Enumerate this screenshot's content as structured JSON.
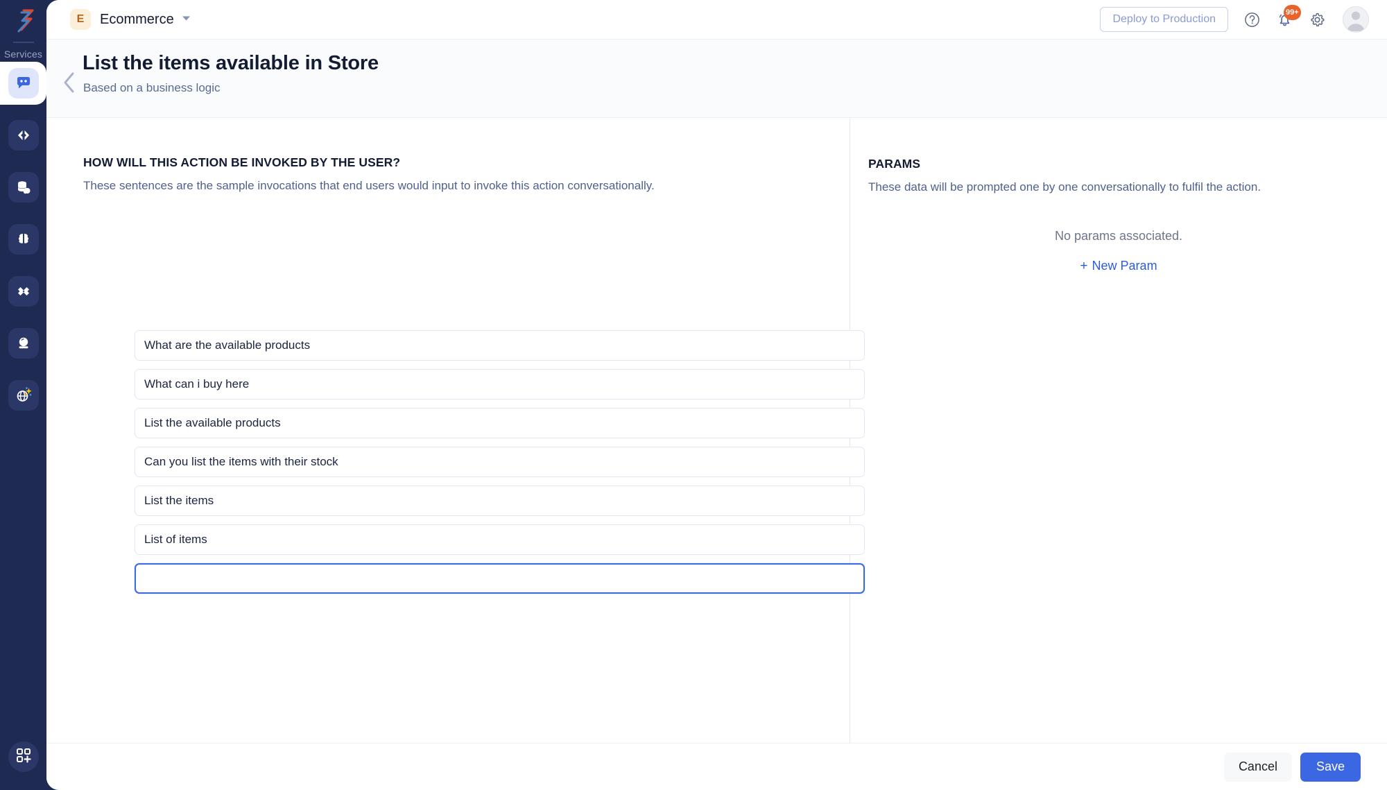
{
  "sidebar": {
    "logo_icon": "zep-logo-icon",
    "section_label": "Services",
    "items": [
      {
        "icon": "chat-bubble-icon",
        "name": "conversations",
        "active": true
      },
      {
        "icon": "code-brackets-icon",
        "name": "code",
        "active": false
      },
      {
        "icon": "database-cloud-icon",
        "name": "database",
        "active": false
      },
      {
        "icon": "brain-icon",
        "name": "intelligence",
        "active": false
      },
      {
        "icon": "infinity-link-icon",
        "name": "integrations",
        "active": false
      },
      {
        "icon": "crystal-ball-icon",
        "name": "insights",
        "active": false
      },
      {
        "icon": "globe-sparkle-icon",
        "name": "ai-globe",
        "active": false
      }
    ],
    "bottom_item": {
      "icon": "grid-plus-icon",
      "name": "add-apps"
    }
  },
  "topbar": {
    "app_badge_letter": "E",
    "app_name": "Ecommerce",
    "caret_icon": "chevron-down-icon",
    "deploy_label": "Deploy to Production",
    "help_icon": "help-circle-icon",
    "notifications_icon": "bell-icon",
    "notifications_count": "99+",
    "settings_icon": "gear-icon",
    "avatar_icon": "avatar-icon"
  },
  "page": {
    "back_icon": "chevron-left-icon",
    "title": "List the items available in Store",
    "subtitle": "Based on a business logic"
  },
  "invocations": {
    "heading": "HOW WILL THIS ACTION BE INVOKED BY THE USER?",
    "description": "These sentences are the sample invocations that end users would input to invoke this action conversationally.",
    "sentences": [
      "What are the available products",
      "What can i buy here",
      "List the available products",
      "Can you list the items with their stock",
      "List the items",
      "List of items"
    ],
    "new_sentence_value": "",
    "new_sentence_placeholder": ""
  },
  "params": {
    "heading": "PARAMS",
    "description": "These data will be prompted one by one conversationally to fulfil the action.",
    "empty_text": "No params associated.",
    "new_param_plus": "+",
    "new_param_label": "New Param"
  },
  "footer": {
    "cancel_label": "Cancel",
    "save_label": "Save"
  },
  "colors": {
    "rail_bg": "#1e2a52",
    "accent_blue": "#3b67e3",
    "badge_orange": "#e8622a",
    "app_badge_bg": "#fbefd9",
    "app_badge_fg": "#b9621c",
    "link_blue": "#2b5ce0"
  }
}
